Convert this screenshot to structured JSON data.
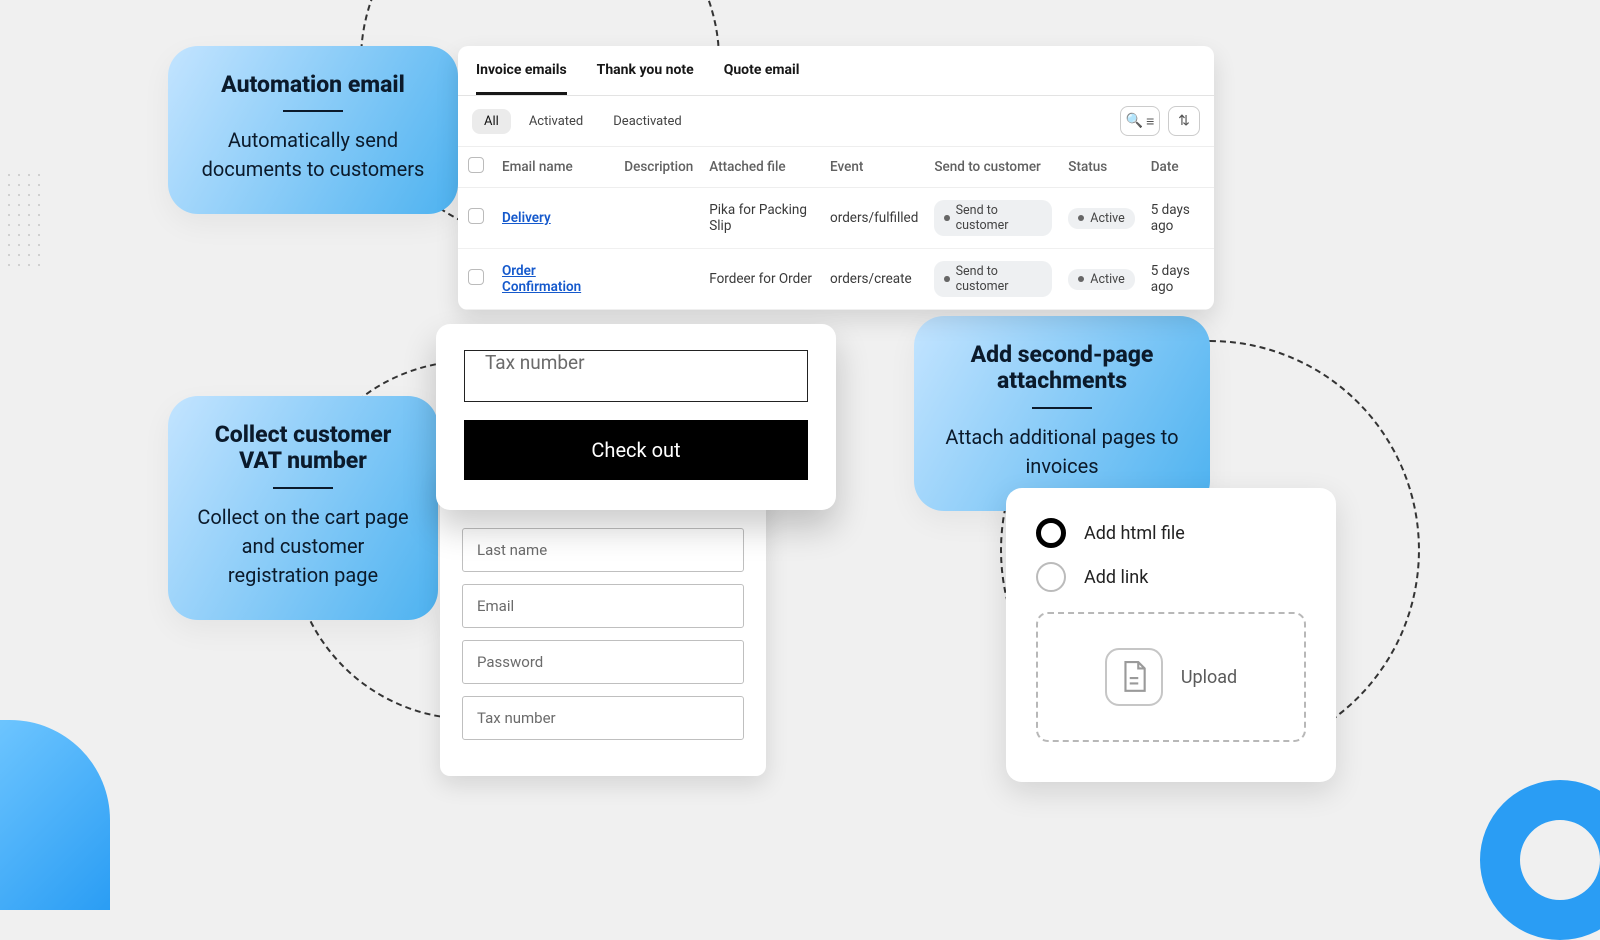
{
  "callouts": {
    "automation": {
      "title": "Automation email",
      "body": "Automatically send documents to customers"
    },
    "vat": {
      "title": "Collect customer VAT number",
      "body": "Collect on the cart page and customer registration page"
    },
    "attachments": {
      "title": "Add second-page attachments",
      "body": "Attach additional pages to invoices"
    }
  },
  "emails": {
    "tabs": [
      "Invoice emails",
      "Thank you note",
      "Quote email"
    ],
    "filters": [
      "All",
      "Activated",
      "Deactivated"
    ],
    "columns": [
      "Email name",
      "Description",
      "Attached file",
      "Event",
      "Send to customer",
      "Status",
      "Date"
    ],
    "rows": [
      {
        "name": "Delivery",
        "description": "",
        "attached": "Pika for Packing Slip",
        "event": "orders/fulfilled",
        "send": "Send to customer",
        "status": "Active",
        "date": "5 days ago"
      },
      {
        "name": "Order Confirmation",
        "description": "",
        "attached": "Fordeer for Order",
        "event": "orders/create",
        "send": "Send to customer",
        "status": "Active",
        "date": "5 days ago"
      }
    ]
  },
  "checkout": {
    "tax_placeholder": "Tax number",
    "button": "Check out"
  },
  "register": {
    "fields": [
      "Last name",
      "Email",
      "Password",
      "Tax number"
    ]
  },
  "attach": {
    "options": [
      "Add html file",
      "Add link"
    ],
    "upload_label": "Upload"
  }
}
